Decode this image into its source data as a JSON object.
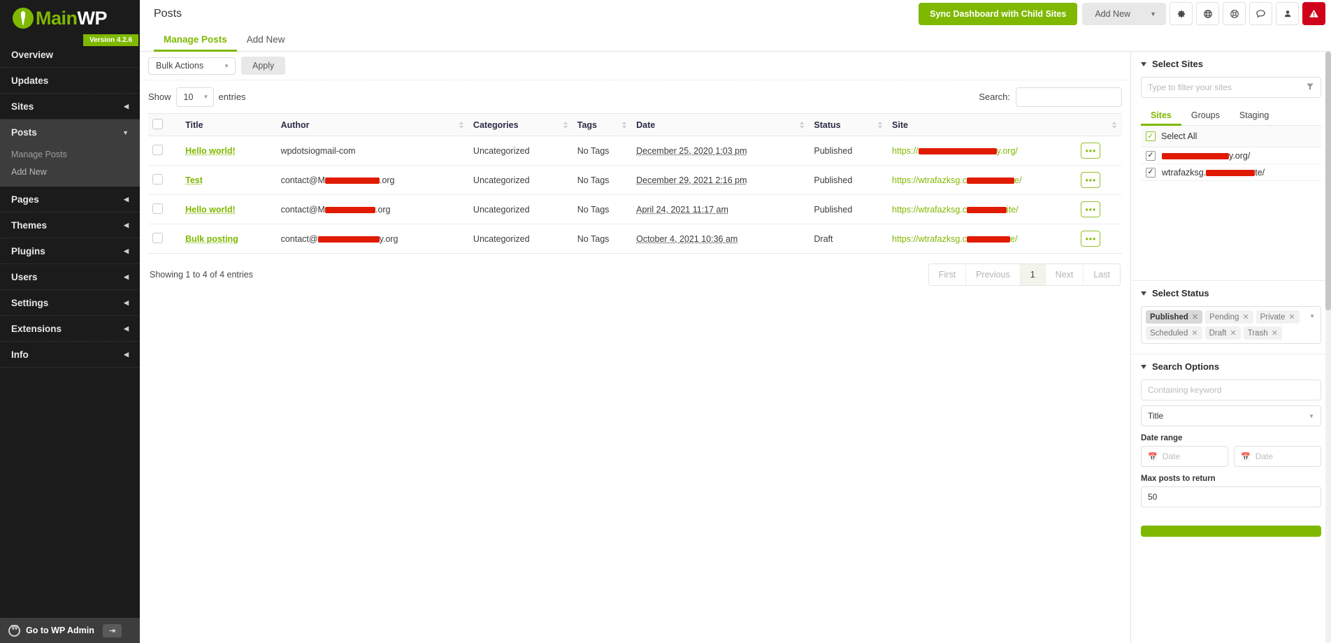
{
  "brand": {
    "name_green": "Main",
    "name_white": "WP",
    "version_badge": "Version 4.2.6"
  },
  "sidebar": {
    "items": [
      {
        "label": "Overview",
        "icon": "",
        "expandable": false,
        "active": false
      },
      {
        "label": "Updates",
        "icon": "",
        "expandable": false,
        "active": false
      },
      {
        "label": "Sites",
        "icon": "caret-left-icon",
        "expandable": true,
        "active": false
      },
      {
        "label": "Posts",
        "icon": "caret-down-icon",
        "expandable": true,
        "active": true
      },
      {
        "label": "Pages",
        "icon": "caret-left-icon",
        "expandable": true,
        "active": false
      },
      {
        "label": "Themes",
        "icon": "caret-left-icon",
        "expandable": true,
        "active": false
      },
      {
        "label": "Plugins",
        "icon": "caret-left-icon",
        "expandable": true,
        "active": false
      },
      {
        "label": "Users",
        "icon": "caret-left-icon",
        "expandable": true,
        "active": false
      },
      {
        "label": "Settings",
        "icon": "caret-left-icon",
        "expandable": true,
        "active": false
      },
      {
        "label": "Extensions",
        "icon": "caret-left-icon",
        "expandable": true,
        "active": false
      },
      {
        "label": "Info",
        "icon": "caret-left-icon",
        "expandable": true,
        "active": false
      }
    ],
    "posts_submenu": [
      {
        "label": "Manage Posts",
        "current": true
      },
      {
        "label": "Add New",
        "current": false
      }
    ],
    "footer": {
      "label": "Go to WP Admin",
      "logo_icon": "wordpress-icon",
      "exit_icon": "sign-out-icon"
    }
  },
  "topbar": {
    "title": "Posts",
    "sync_label": "Sync Dashboard with Child Sites",
    "add_new_label": "Add New",
    "icons": [
      "gear-icon",
      "globe-icon",
      "life-ring-icon",
      "comment-icon",
      "user-icon",
      "warning-triangle-icon"
    ]
  },
  "tabs": [
    {
      "label": "Manage Posts",
      "active": true
    },
    {
      "label": "Add New",
      "active": false
    }
  ],
  "toolbar": {
    "bulk_actions_label": "Bulk Actions",
    "apply_label": "Apply"
  },
  "table_controls": {
    "show_label": "Show",
    "show_value": "10",
    "entries_label": "entries",
    "search_label": "Search:",
    "search_value": "",
    "search_placeholder": ""
  },
  "table": {
    "columns": [
      "Title",
      "Author",
      "Categories",
      "Tags",
      "Date",
      "Status",
      "Site",
      ""
    ],
    "rows": [
      {
        "title": "Hello world!",
        "author_prefix": "wpdotsiogmail-com",
        "author_redact": 0,
        "author_suffix": "",
        "categories": "Uncategorized",
        "tags": "No Tags",
        "date": "December 25, 2020 1:03 pm",
        "status": "Published",
        "site_prefix": "https://",
        "site_redact": 112,
        "site_suffix": "y.org/",
        "action": "•••"
      },
      {
        "title": "Test",
        "author_prefix": "contact@M",
        "author_redact": 78,
        "author_suffix": ".org",
        "categories": "Uncategorized",
        "tags": "No Tags",
        "date": "December 29, 2021 2:16 pm",
        "status": "Published",
        "site_prefix": "https://wtrafazksg.c",
        "site_redact": 68,
        "site_suffix": "e/",
        "action": "•••"
      },
      {
        "title": "Hello world!",
        "author_prefix": "contact@M",
        "author_redact": 72,
        "author_suffix": ".org",
        "categories": "Uncategorized",
        "tags": "No Tags",
        "date": "April 24, 2021 11:17 am",
        "status": "Published",
        "site_prefix": "https://wtrafazksg.c",
        "site_redact": 57,
        "site_suffix": "ite/",
        "action": "•••"
      },
      {
        "title": "Bulk posting",
        "author_prefix": "contact@",
        "author_redact": 88,
        "author_suffix": "y.org",
        "categories": "Uncategorized",
        "tags": "No Tags",
        "date": "October 4, 2021 10:36 am",
        "status": "Draft",
        "site_prefix": "https://wtrafazksg.c",
        "site_redact": 62,
        "site_suffix": "e/",
        "action": "•••"
      }
    ]
  },
  "footer": {
    "showing_text": "Showing 1 to 4 of 4 entries",
    "pagination": [
      {
        "label": "First",
        "current": false
      },
      {
        "label": "Previous",
        "current": false
      },
      {
        "label": "1",
        "current": true
      },
      {
        "label": "Next",
        "current": false
      },
      {
        "label": "Last",
        "current": false
      }
    ]
  },
  "right_panel": {
    "select_sites": {
      "heading": "Select Sites",
      "filter_placeholder": "Type to filter your sites",
      "filter_value": "",
      "filter_icon": "funnel-icon",
      "tabs": [
        {
          "label": "Sites",
          "active": true
        },
        {
          "label": "Groups",
          "active": false
        },
        {
          "label": "Staging",
          "active": false
        }
      ],
      "select_all_label": "Select All",
      "sites": [
        {
          "prefix": "",
          "redact": 96,
          "suffix": "y.org/",
          "checked": true
        },
        {
          "prefix": "wtrafazksg.",
          "redact": 70,
          "suffix": "te/",
          "checked": true
        }
      ]
    },
    "select_status": {
      "heading": "Select Status",
      "tags": [
        {
          "label": "Published",
          "selected": true
        },
        {
          "label": "Pending",
          "selected": false
        },
        {
          "label": "Private",
          "selected": false
        },
        {
          "label": "Scheduled",
          "selected": false
        },
        {
          "label": "Draft",
          "selected": false
        },
        {
          "label": "Trash",
          "selected": false
        }
      ]
    },
    "search_options": {
      "heading": "Search Options",
      "keyword_placeholder": "Containing keyword",
      "keyword_value": "",
      "scope_value": "Title",
      "date_range_label": "Date range",
      "date_from_placeholder": "Date",
      "date_to_placeholder": "Date",
      "max_posts_label": "Max posts to return",
      "max_posts_value": "50"
    }
  }
}
